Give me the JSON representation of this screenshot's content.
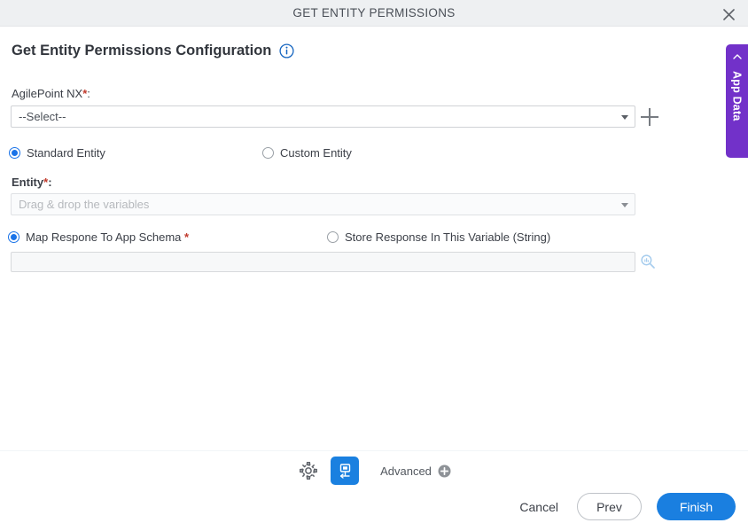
{
  "window": {
    "title": "GET ENTITY PERMISSIONS",
    "close_icon": "close-icon"
  },
  "page": {
    "heading": "Get Entity Permissions Configuration",
    "info_icon": "info-circle-icon"
  },
  "form": {
    "access_token": {
      "label": "AgilePoint NX",
      "required_mark": "*",
      "colon": ":",
      "selected_value": "--Select--",
      "add_icon": "plus-icon"
    },
    "entity_type": {
      "options": [
        {
          "label": "Standard Entity",
          "selected": true
        },
        {
          "label": "Custom Entity",
          "selected": false
        }
      ]
    },
    "entity": {
      "label": "Entity",
      "required_mark": "*",
      "colon": ":",
      "placeholder": "Drag & drop the variables",
      "value": ""
    },
    "response": {
      "options": [
        {
          "label": "Map Respone To App Schema",
          "required_mark": "*",
          "selected": true
        },
        {
          "label": "Store Response In This Variable (String)",
          "required_mark": "",
          "selected": false
        }
      ],
      "input_value": "",
      "input_placeholder": "",
      "search_icon": "magnifier-icon"
    }
  },
  "side_tab": {
    "label": "App Data",
    "chevron_icon": "chevron-left-icon",
    "color": "#7231c9"
  },
  "toolbar": {
    "settings_icon": "gear-icon",
    "screen_icon": "screen-capture-icon",
    "advanced_label": "Advanced",
    "advanced_add_icon": "plus-circle-icon"
  },
  "actions": {
    "cancel_label": "Cancel",
    "prev_label": "Prev",
    "finish_label": "Finish",
    "primary_color": "#1a7fe0"
  }
}
